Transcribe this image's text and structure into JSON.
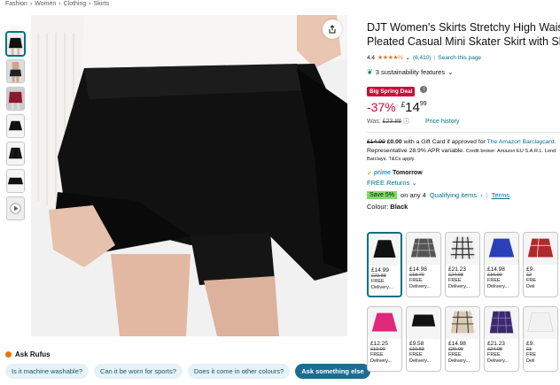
{
  "breadcrumb": [
    "Fashion",
    "Women",
    "Clothing",
    "Skirts"
  ],
  "breadcrumb_sep": "›",
  "product": {
    "title": "DJT Women's Skirts Stretchy High Waist Pleated Casual Mini Skater Skirt with Shorts",
    "rating": "4.4",
    "rating_count": "(6,410)",
    "search_link": "Search this page",
    "separator": "|",
    "sustainability": "3 sustainability features"
  },
  "deal": {
    "badge": "Big Spring Deal",
    "discount": "-37%",
    "currency": "£",
    "price_whole": "14",
    "price_fraction": "99",
    "was_label": "Was:",
    "was_price": "£23.88",
    "price_history": "Price history"
  },
  "gift_card": {
    "old_price": "£14.99",
    "new_price": "£0.00",
    "text": "with a Gift Card if approved for",
    "link": "The Amazon Barclaycard.",
    "apr_line": "Representative 28.9% APR variable.",
    "broker": "Credit broker: Amazon EU S.A.R.L. Lend",
    "broker_line2": "Barclays. T&Cs apply."
  },
  "delivery": {
    "prime_label": "prime",
    "delivery_day": "Tomorrow",
    "returns": "FREE Returns"
  },
  "savings": {
    "badge": "Save 5%",
    "on_text": "on any 4",
    "qualifying": "Qualifying items",
    "terms": "Terms"
  },
  "colour": {
    "label": "Colour:",
    "value": "Black"
  },
  "swatches_row1": [
    {
      "price": "£14.99",
      "was": "£23.88",
      "free": "FREE",
      "delivery": "Delivery..."
    },
    {
      "price": "£14.98",
      "was": "£18.70",
      "free": "FREE",
      "delivery": "Delivery..."
    },
    {
      "price": "£21.23",
      "was": "£24.98",
      "free": "FREE",
      "delivery": "Delivery..."
    },
    {
      "price": "£14.98",
      "was": "£16.90",
      "free": "FREE",
      "delivery": "Delivery..."
    },
    {
      "price": "£9.",
      "was": "£2",
      "free": "FRE",
      "delivery": "Deli"
    }
  ],
  "swatches_row2": [
    {
      "price": "£12.25",
      "was": "£12.90",
      "free": "FREE",
      "delivery": "Delivery..."
    },
    {
      "price": "£9.58",
      "was": "£10.83",
      "free": "FREE",
      "delivery": "Delivery..."
    },
    {
      "price": "£14.98",
      "was": "£20.99",
      "free": "FREE",
      "delivery": "Delivery..."
    },
    {
      "price": "£21.23",
      "was": "£24.98",
      "free": "FREE",
      "delivery": "Delivery..."
    },
    {
      "price": "£9.",
      "was": "£1",
      "free": "FRE",
      "delivery": "Deli"
    }
  ],
  "rufus": {
    "title": "Ask Rufus",
    "chips": [
      "Is it machine washable?",
      "Can it be worn for sports?",
      "Does it come in other colours?"
    ],
    "primary_chip": "Ask something else"
  },
  "colors": {
    "link": "#007185",
    "deal_red": "#cc0c39",
    "star": "#de7921",
    "prime": "#1399ff",
    "save_green": "#7fda69"
  }
}
